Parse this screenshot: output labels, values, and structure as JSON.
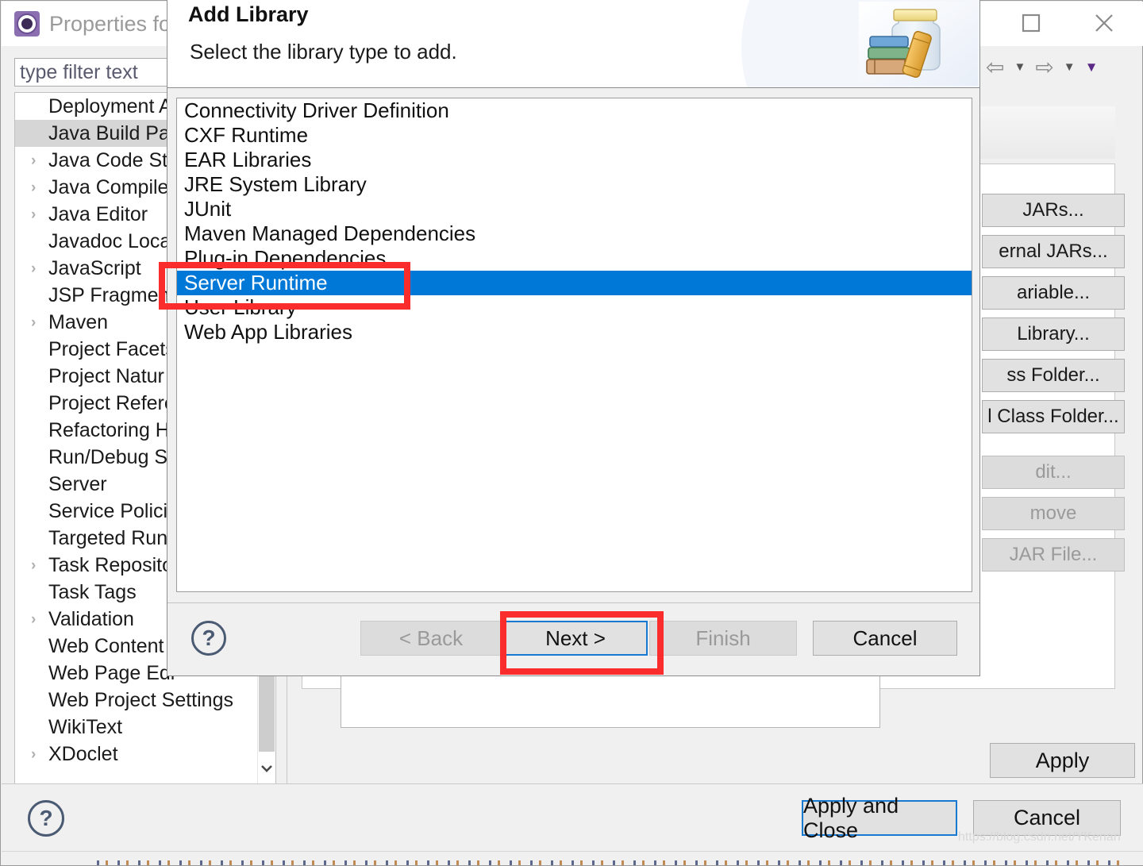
{
  "properties_window": {
    "title": "Properties for",
    "title_icon": "gear-icon",
    "window_controls": {
      "maximize": "maximize-icon",
      "close": "close-icon"
    },
    "filter": {
      "value": "type filter text",
      "placeholder": "type filter text"
    },
    "tree": {
      "items": [
        {
          "label": "Deployment A",
          "expandable": false,
          "selected": false
        },
        {
          "label": "Java Build Pat",
          "expandable": false,
          "selected": true
        },
        {
          "label": "Java Code Sty",
          "expandable": true,
          "selected": false
        },
        {
          "label": "Java Compiler",
          "expandable": true,
          "selected": false
        },
        {
          "label": "Java Editor",
          "expandable": true,
          "selected": false
        },
        {
          "label": "Javadoc Locat",
          "expandable": false,
          "selected": false
        },
        {
          "label": "JavaScript",
          "expandable": true,
          "selected": false
        },
        {
          "label": "JSP Fragment",
          "expandable": false,
          "selected": false
        },
        {
          "label": "Maven",
          "expandable": true,
          "selected": false
        },
        {
          "label": "Project Facets",
          "expandable": false,
          "selected": false
        },
        {
          "label": "Project Natur",
          "expandable": false,
          "selected": false
        },
        {
          "label": "Project Refere",
          "expandable": false,
          "selected": false
        },
        {
          "label": "Refactoring H",
          "expandable": false,
          "selected": false
        },
        {
          "label": "Run/Debug S",
          "expandable": false,
          "selected": false
        },
        {
          "label": "Server",
          "expandable": false,
          "selected": false
        },
        {
          "label": "Service Policie",
          "expandable": false,
          "selected": false
        },
        {
          "label": "Targeted Run",
          "expandable": false,
          "selected": false
        },
        {
          "label": "Task Reposito",
          "expandable": true,
          "selected": false
        },
        {
          "label": "Task Tags",
          "expandable": false,
          "selected": false
        },
        {
          "label": "Validation",
          "expandable": true,
          "selected": false
        },
        {
          "label": "Web Content",
          "expandable": false,
          "selected": false
        },
        {
          "label": "Web Page Edi",
          "expandable": false,
          "selected": false
        },
        {
          "label": "Web Project Settings",
          "expandable": false,
          "selected": false
        },
        {
          "label": "WikiText",
          "expandable": false,
          "selected": false
        },
        {
          "label": "XDoclet",
          "expandable": true,
          "selected": false
        }
      ]
    },
    "build_path_buttons": [
      {
        "label": "JARs...",
        "enabled": true
      },
      {
        "label": "ernal JARs...",
        "enabled": true
      },
      {
        "label": "ariable...",
        "enabled": true
      },
      {
        "label": "Library...",
        "enabled": true
      },
      {
        "label": "ss Folder...",
        "enabled": true
      },
      {
        "label": "l Class Folder...",
        "enabled": true
      },
      {
        "label": "dit...",
        "enabled": false
      },
      {
        "label": "move",
        "enabled": false
      },
      {
        "label": "JAR File...",
        "enabled": false
      }
    ],
    "apply_button": "Apply",
    "bottom_bar": {
      "help_icon": "help-icon",
      "apply_and_close": "Apply and Close",
      "cancel": "Cancel"
    },
    "watermark": "https://blog.csdn.net/YKenan"
  },
  "dialog": {
    "title": "Add Library",
    "subtitle": "Select the library type to add.",
    "header_icon": "jar-with-books-icon",
    "library_types": [
      {
        "label": "Connectivity Driver Definition",
        "selected": false
      },
      {
        "label": "CXF Runtime",
        "selected": false
      },
      {
        "label": "EAR Libraries",
        "selected": false
      },
      {
        "label": "JRE System Library",
        "selected": false
      },
      {
        "label": "JUnit",
        "selected": false
      },
      {
        "label": "Maven Managed Dependencies",
        "selected": false
      },
      {
        "label": "Plug-in Dependencies",
        "selected": false
      },
      {
        "label": "Server Runtime",
        "selected": true
      },
      {
        "label": "User Library",
        "selected": false
      },
      {
        "label": "Web App Libraries",
        "selected": false
      }
    ],
    "footer": {
      "help_icon": "help-icon",
      "back": "< Back",
      "next": "Next >",
      "finish": "Finish",
      "cancel": "Cancel"
    }
  },
  "annotations": {
    "accent_color": "#fb2c2c",
    "selection_color": "#0078d7",
    "focus_color": "#1879d0",
    "boxes": [
      {
        "target": "Server Runtime"
      },
      {
        "target": "Next >"
      }
    ]
  }
}
